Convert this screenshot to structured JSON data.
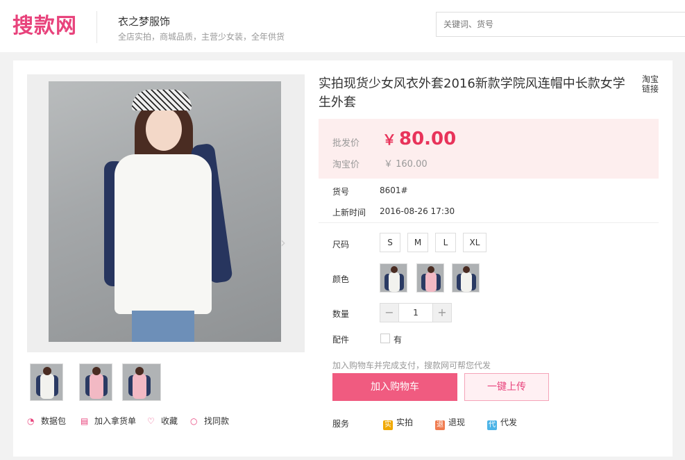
{
  "header": {
    "logo": "搜款网",
    "shop_name": "衣之梦服饰",
    "shop_desc": "全店实拍，商城品质，主营少女装，全年供货",
    "search_placeholder": "关键词、货号"
  },
  "product": {
    "title": "实拍现货少女风衣外套2016新款学院风连帽中长款女学生外套",
    "taobao_link": "淘宝链接",
    "price": {
      "wholesale_label": "批发价",
      "currency": "￥",
      "wholesale_value": "80.00",
      "taobao_label": "淘宝价",
      "taobao_value": "￥ 160.00"
    },
    "sku_label": "货号",
    "sku": "8601#",
    "time_label": "上新时间",
    "time": "2016-08-26 17:30",
    "size_label": "尺码",
    "sizes": [
      "S",
      "M",
      "L",
      "XL"
    ],
    "color_label": "颜色",
    "quantity_label": "数量",
    "quantity": "1",
    "minus": "−",
    "plus": "+",
    "accessory_label": "配件",
    "accessory_option": "有",
    "note": "加入购物车并完成支付，搜款网可帮您代发",
    "add_cart": "加入购物车",
    "one_click_upload": "一键上传",
    "service_label": "服务",
    "services": [
      {
        "badge": "实",
        "label": "实拍",
        "color": "#f0a800"
      },
      {
        "badge": "退",
        "label": "退现",
        "color": "#f07b4f"
      },
      {
        "badge": "代",
        "label": "代发",
        "color": "#4cb4e7"
      }
    ]
  },
  "gallery_actions": [
    {
      "label": "数据包",
      "icon": "chart-icon"
    },
    {
      "label": "加入拿货单",
      "icon": "list-icon"
    },
    {
      "label": "收藏",
      "icon": "heart-icon"
    },
    {
      "label": "找同款",
      "icon": "search-icon"
    }
  ],
  "colors": {
    "accent": "#e8437c",
    "price": "#e8335a",
    "cart_button": "#f05b80"
  }
}
